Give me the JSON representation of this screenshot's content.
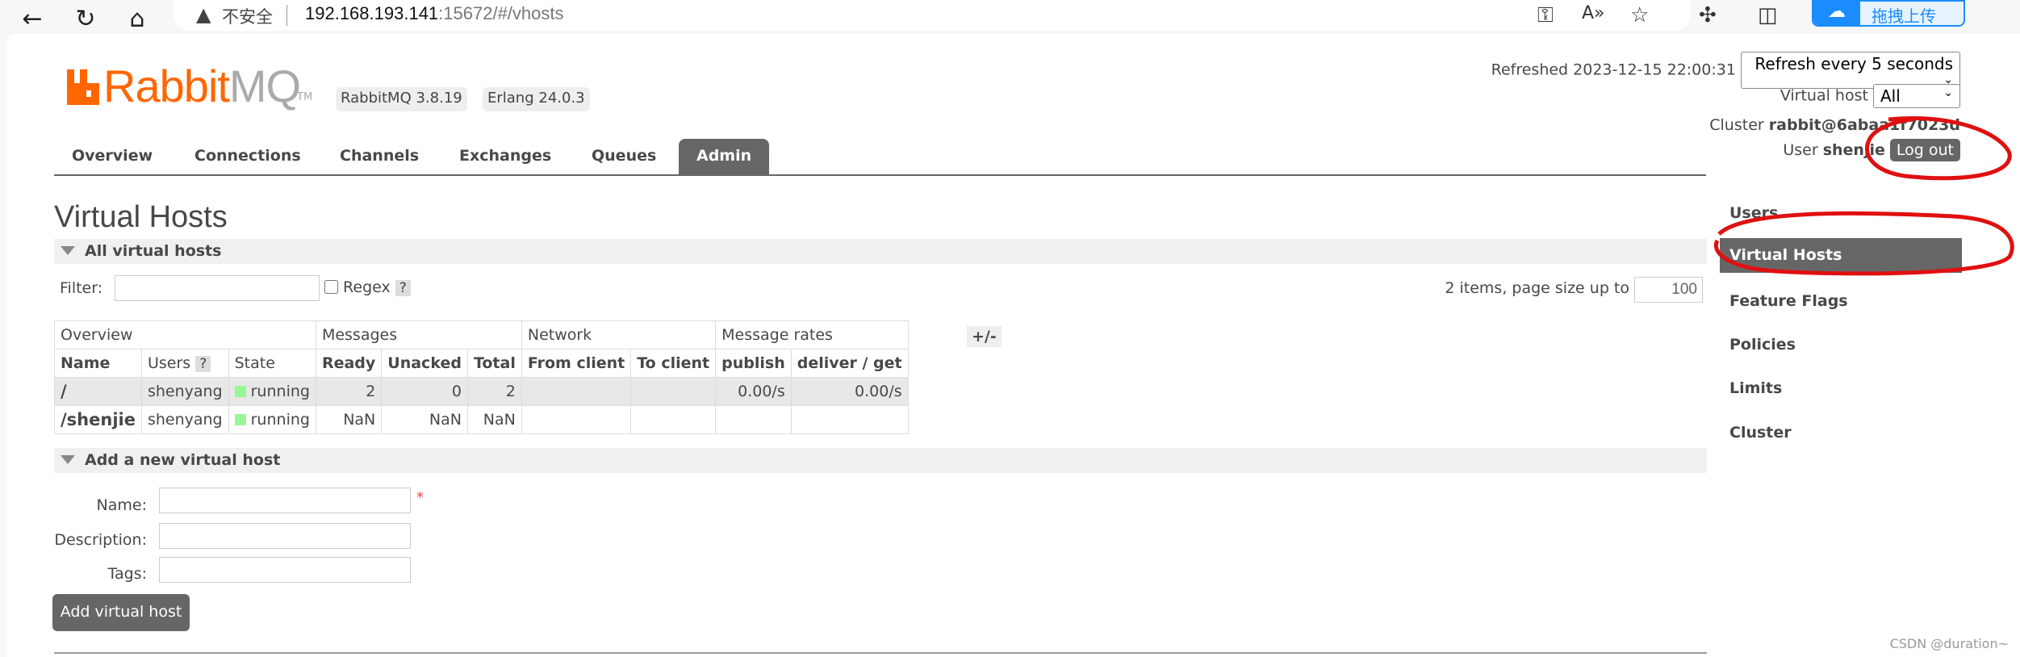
{
  "browser": {
    "insecure_label": "不安全",
    "url_host": "192.168.193.141",
    "url_rest": ":15672/#/vhosts",
    "upload_label": "拖拽上传",
    "icons": [
      "back-icon",
      "reload-icon",
      "home-icon",
      "warning-icon",
      "key-icon",
      "read-aloud-icon",
      "star-icon",
      "extensions-icon",
      "split-screen-icon",
      "baidu-cloud-icon"
    ]
  },
  "header": {
    "logo_text_a": "Rabbit",
    "logo_text_b": "MQ",
    "logo_tm": "TM",
    "version_badge": "RabbitMQ 3.8.19",
    "erlang_badge": "Erlang 24.0.3",
    "refreshed": "Refreshed 2023-12-15 22:00:31",
    "refresh_select": "Refresh every 5 seconds",
    "vhost_label": "Virtual host",
    "vhost_select": "All",
    "cluster_label": "Cluster",
    "cluster_value": "rabbit@6abaa1f7023d",
    "user_label": "User",
    "user_value": "shenjie",
    "logout": "Log out",
    "brand_color": "#ff6600"
  },
  "tabs": [
    {
      "label": "Overview"
    },
    {
      "label": "Connections"
    },
    {
      "label": "Channels"
    },
    {
      "label": "Exchanges"
    },
    {
      "label": "Queues"
    },
    {
      "label": "Admin",
      "active": true
    }
  ],
  "main": {
    "title": "Virtual Hosts",
    "section_all": "All virtual hosts",
    "filter_label": "Filter:",
    "filter_value": "",
    "regex_label": "Regex",
    "help": "?",
    "items_text": "2 items, page size up to",
    "page_size": "100",
    "plus_minus": "+/-",
    "table": {
      "groups": [
        "Overview",
        "Messages",
        "Network",
        "Message rates"
      ],
      "columns": [
        "Name",
        "Users",
        "State",
        "Ready",
        "Unacked",
        "Total",
        "From client",
        "To client",
        "publish",
        "deliver / get"
      ],
      "rows": [
        {
          "name": "/",
          "users": "shenyang",
          "state": "running",
          "ready": "2",
          "unacked": "0",
          "total": "2",
          "from_client": "",
          "to_client": "",
          "publish": "0.00/s",
          "deliver_get": "0.00/s"
        },
        {
          "name": "/shenjie",
          "users": "shenyang",
          "state": "running",
          "ready": "NaN",
          "unacked": "NaN",
          "total": "NaN",
          "from_client": "",
          "to_client": "",
          "publish": "",
          "deliver_get": ""
        }
      ]
    },
    "section_add": "Add a new virtual host",
    "name_label": "Name:",
    "required": "*",
    "desc_label": "Description:",
    "tags_label": "Tags:",
    "add_button": "Add virtual host"
  },
  "sidebar": {
    "items": [
      {
        "label": "Users"
      },
      {
        "label": "Virtual Hosts",
        "active": true
      },
      {
        "label": "Feature Flags"
      },
      {
        "label": "Policies"
      },
      {
        "label": "Limits"
      },
      {
        "label": "Cluster"
      }
    ]
  },
  "watermark": "CSDN @duration~"
}
